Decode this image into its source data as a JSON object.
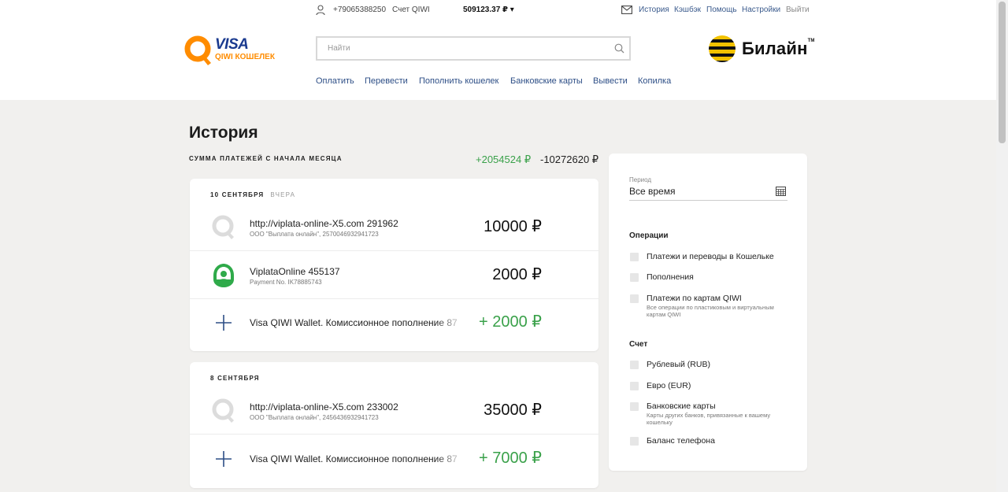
{
  "topbar": {
    "phone": "+79065388250",
    "account_label": "Счет QIWI",
    "balance": "509123.37 ₽",
    "balance_arrow": "▾",
    "links": [
      "История",
      "Кэшбэк",
      "Помощь",
      "Настройки",
      "Выйти"
    ]
  },
  "logo": {
    "visa": "VISA",
    "qiwi": "QIWI КОШЕЛЕК"
  },
  "search": {
    "placeholder": "Найти"
  },
  "operator": {
    "name": "Билайн",
    "tm": "TM"
  },
  "nav": [
    "Оплатить",
    "Перевести",
    "Пополнить кошелек",
    "Банковские карты",
    "Вывести",
    "Копилка"
  ],
  "page": {
    "title": "История",
    "sum_label": "СУММА ПЛАТЕЖЕЙ С НАЧАЛА МЕСЯЦА",
    "sum_in": "+2054524 ₽",
    "sum_out": "-10272620 ₽"
  },
  "groups": [
    {
      "date": "10 СЕНТЯБРЯ",
      "date_sub": "ВЧЕРА",
      "items": [
        {
          "icon": "qiwi-grey-icon",
          "title": "http://viplata-online-X5.com 291962",
          "subtitle": "ООО \"Выплата онлайн\", 2570046932941723",
          "amount": "10000 ₽",
          "positive": false
        },
        {
          "icon": "viplata-green-icon",
          "title": "ViplataOnline 455137",
          "subtitle": "Payment No. IK78885743",
          "amount": "2000 ₽",
          "positive": false
        },
        {
          "icon": "plus-icon",
          "title": "Visa QIWI Wallet. Комиссионное пополнение 87",
          "subtitle": "",
          "amount": "+ 2000 ₽",
          "positive": true
        }
      ]
    },
    {
      "date": "8 СЕНТЯБРЯ",
      "date_sub": "",
      "items": [
        {
          "icon": "qiwi-grey-icon",
          "title": "http://viplata-online-X5.com 233002",
          "subtitle": "ООО \"Выплата онлайн\", 2456436932941723",
          "amount": "35000 ₽",
          "positive": false
        },
        {
          "icon": "plus-icon",
          "title": "Visa QIWI Wallet. Комиссионное пополнение 87",
          "subtitle": "",
          "amount": "+ 7000 ₽",
          "positive": true
        }
      ]
    }
  ],
  "filter": {
    "period_label": "Период",
    "period_value": "Все время",
    "operations_title": "Операции",
    "operations": [
      {
        "label": "Платежи и переводы в Кошельке",
        "hint": ""
      },
      {
        "label": "Пополнения",
        "hint": ""
      },
      {
        "label": "Платежи по картам QIWI",
        "hint": "Все операции по пластиковым и виртуальным картам QIWI"
      }
    ],
    "account_title": "Счет",
    "accounts": [
      {
        "label": "Рублевый (RUB)",
        "hint": ""
      },
      {
        "label": "Евро (EUR)",
        "hint": ""
      },
      {
        "label": "Банковские карты",
        "hint": "Карты других банков, привязанные к вашему кошельку"
      },
      {
        "label": "Баланс телефона",
        "hint": ""
      }
    ]
  },
  "colors": {
    "link": "#2d4e86",
    "positive": "#3aa14a",
    "brand_orange": "#ff8c00",
    "brand_blue": "#1a3a8f"
  }
}
